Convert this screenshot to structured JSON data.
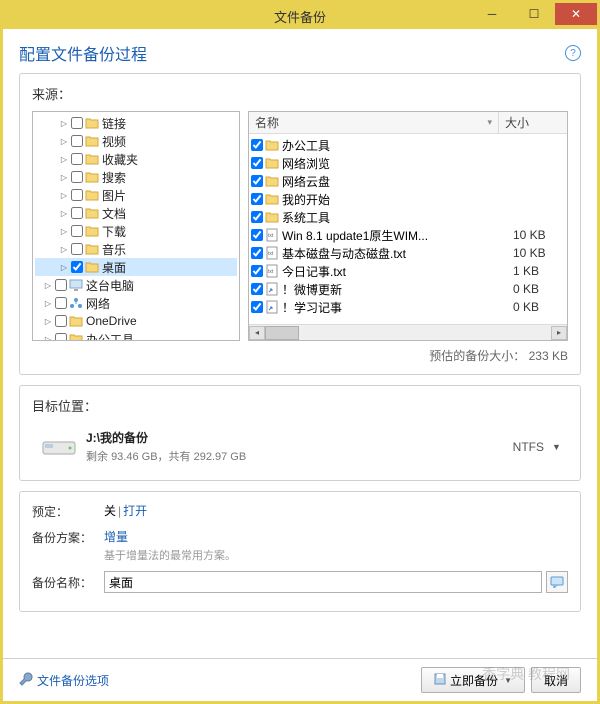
{
  "window": {
    "title": "文件备份"
  },
  "page": {
    "title": "配置文件备份过程"
  },
  "source": {
    "label": "来源：",
    "tree": [
      {
        "indent": 1,
        "has_expander": true,
        "checked": false,
        "icon": "folder",
        "label": "链接"
      },
      {
        "indent": 1,
        "has_expander": true,
        "checked": false,
        "icon": "folder",
        "label": "视频"
      },
      {
        "indent": 1,
        "has_expander": true,
        "checked": false,
        "icon": "folder",
        "label": "收藏夹"
      },
      {
        "indent": 1,
        "has_expander": true,
        "checked": false,
        "icon": "folder",
        "label": "搜索"
      },
      {
        "indent": 1,
        "has_expander": true,
        "checked": false,
        "icon": "folder",
        "label": "图片"
      },
      {
        "indent": 1,
        "has_expander": true,
        "checked": false,
        "icon": "folder",
        "label": "文档"
      },
      {
        "indent": 1,
        "has_expander": true,
        "checked": false,
        "icon": "folder",
        "label": "下载"
      },
      {
        "indent": 1,
        "has_expander": true,
        "checked": false,
        "icon": "folder",
        "label": "音乐"
      },
      {
        "indent": 1,
        "has_expander": true,
        "checked": true,
        "icon": "folder",
        "label": "桌面",
        "selected": true
      },
      {
        "indent": 0,
        "has_expander": true,
        "checked": false,
        "icon": "computer",
        "label": "这台电脑"
      },
      {
        "indent": 0,
        "has_expander": true,
        "checked": false,
        "icon": "network",
        "label": "网络"
      },
      {
        "indent": 0,
        "has_expander": true,
        "checked": false,
        "icon": "folder",
        "label": "OneDrive"
      },
      {
        "indent": 0,
        "has_expander": true,
        "checked": false,
        "icon": "folder",
        "label": "办公工具"
      }
    ],
    "list_headers": {
      "name": "名称",
      "size": "大小"
    },
    "list": [
      {
        "checked": true,
        "icon": "folder",
        "name": "办公工具",
        "size": ""
      },
      {
        "checked": true,
        "icon": "folder",
        "name": "网络浏览",
        "size": ""
      },
      {
        "checked": true,
        "icon": "folder",
        "name": "网络云盘",
        "size": ""
      },
      {
        "checked": true,
        "icon": "folder",
        "name": "我的开始",
        "size": ""
      },
      {
        "checked": true,
        "icon": "folder",
        "name": "系统工具",
        "size": ""
      },
      {
        "checked": true,
        "icon": "txt",
        "name": "Win 8.1 update1原生WIM...",
        "size": "10 KB"
      },
      {
        "checked": true,
        "icon": "txt",
        "name": "基本磁盘与动态磁盘.txt",
        "size": "10 KB"
      },
      {
        "checked": true,
        "icon": "txt",
        "name": "今日记事.txt",
        "size": "1 KB"
      },
      {
        "checked": true,
        "icon": "shortcut",
        "name": "！微博更新",
        "size": "0 KB"
      },
      {
        "checked": true,
        "icon": "shortcut",
        "name": "！学习记事",
        "size": "0 KB"
      }
    ],
    "estimate_label": "预估的备份大小：",
    "estimate_value": "233 KB"
  },
  "target": {
    "label": "目标位置：",
    "path": "J:\\我的备份",
    "sub_prefix": "剩余 ",
    "free": "93.46 GB",
    "sub_mid": "，共有 ",
    "total": "292.97 GB",
    "fs": "NTFS"
  },
  "settings": {
    "schedule_label": "预定：",
    "schedule_off": "关",
    "schedule_open": "打开",
    "scheme_label": "备份方案：",
    "scheme_value": "增量",
    "scheme_hint": "基于增量法的最常用方案。",
    "name_label": "备份名称：",
    "name_value": "桌面"
  },
  "footer": {
    "options": "文件备份选项",
    "backup_now": "立即备份",
    "cancel": "取消"
  },
  "watermark": "香字典 教程网"
}
